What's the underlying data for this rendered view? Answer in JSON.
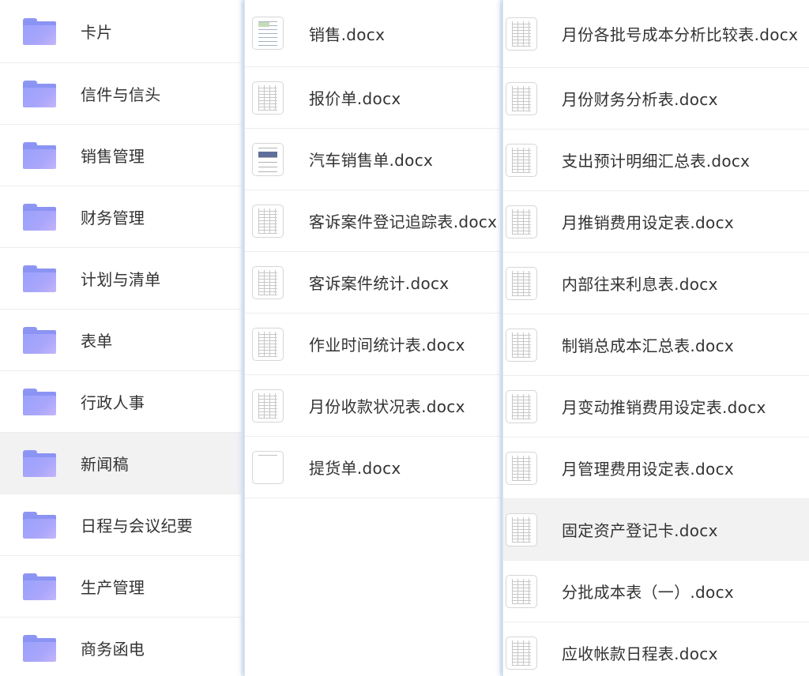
{
  "folders": [
    {
      "label": "卡片"
    },
    {
      "label": "信件与信头"
    },
    {
      "label": "销售管理"
    },
    {
      "label": "财务管理"
    },
    {
      "label": "计划与清单"
    },
    {
      "label": "表单"
    },
    {
      "label": "行政人事"
    },
    {
      "label": "新闻稿",
      "selected": true
    },
    {
      "label": "日程与会议纪要"
    },
    {
      "label": "生产管理"
    },
    {
      "label": "商务函电"
    }
  ],
  "files_col1": [
    {
      "label": "销售.docx"
    },
    {
      "label": "报价单.docx"
    },
    {
      "label": "汽车销售单.docx"
    },
    {
      "label": "客诉案件登记追踪表.docx"
    },
    {
      "label": "客诉案件统计.docx"
    },
    {
      "label": "作业时间统计表.docx"
    },
    {
      "label": "月份收款状况表.docx"
    },
    {
      "label": "提货单.docx"
    }
  ],
  "files_col2": [
    {
      "label": "月份各批号成本分析比较表.docx"
    },
    {
      "label": "月份财务分析表.docx"
    },
    {
      "label": "支出预计明细汇总表.docx"
    },
    {
      "label": "月推销费用设定表.docx"
    },
    {
      "label": "内部往来利息表.docx"
    },
    {
      "label": "制销总成本汇总表.docx"
    },
    {
      "label": "月变动推销费用设定表.docx"
    },
    {
      "label": "月管理费用设定表.docx"
    },
    {
      "label": "固定资产登记卡.docx",
      "selected": true
    },
    {
      "label": "分批成本表（一）.docx"
    },
    {
      "label": "应收帐款日程表.docx"
    }
  ],
  "icons": {
    "folder": "folder-icon",
    "file": "document-thumbnail-icon"
  },
  "colors": {
    "folder": "#9aa1fb",
    "selected_row": "#f2f2f3",
    "column_divider": "#d9e4f3"
  }
}
